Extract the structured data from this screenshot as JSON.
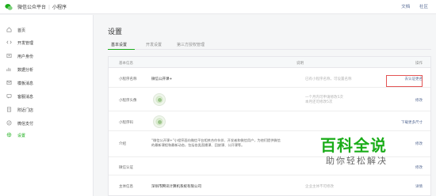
{
  "topbar": {
    "brand": "微信公众平台",
    "product": "小程序",
    "links": [
      "文档",
      "社区"
    ]
  },
  "sidebar": {
    "items": [
      {
        "label": "首页",
        "icon": "home-icon"
      },
      {
        "label": "开发管理",
        "icon": "code-icon"
      },
      {
        "label": "用户身份",
        "icon": "user-icon"
      },
      {
        "label": "数据分析",
        "icon": "chart-icon"
      },
      {
        "label": "模板消息",
        "icon": "message-icon"
      },
      {
        "label": "客服消息",
        "icon": "service-icon"
      },
      {
        "label": "附近门店",
        "icon": "store-icon"
      },
      {
        "label": "微信支付",
        "icon": "pay-icon"
      },
      {
        "label": "设置",
        "icon": "gear-icon",
        "active": true
      }
    ]
  },
  "main": {
    "title": "设置",
    "tabs": [
      "基本设置",
      "开发设置",
      "第三方授权管理"
    ],
    "table": {
      "headers": [
        "基本信息",
        "说明",
        "操作"
      ],
      "rows": [
        {
          "name": "小程序名称",
          "content": "微信公开课+",
          "desc": "已有小程序名称，可设置名称",
          "op": "去认证更名"
        },
        {
          "name": "小程序头像",
          "content": "",
          "desc": "一个月内可申请修改5次\n本月还可修改5次",
          "op": "修改"
        },
        {
          "name": "小程序码",
          "content": "",
          "desc": "",
          "op": "下载更多尺寸"
        },
        {
          "name": "介绍",
          "content": "“微信公开课+”小程序面向微信平台相关合作伙伴、开发者和微信用户，为他们提供微信\n的最新课程和最新动态，包括各类直播课、回放课、公开课等。",
          "desc": "",
          "op": "修改"
        },
        {
          "name": "微信认证",
          "content": "",
          "desc": "",
          "op": "修改"
        },
        {
          "name": "主体信息",
          "content": "深圳市腾讯计算机系统有限公司",
          "desc": "企业主体不可修改",
          "op": "详情"
        }
      ]
    }
  },
  "watermark": {
    "title": "百科全说",
    "subtitle": "助你轻松解决"
  },
  "colors": {
    "accent": "#1aad19",
    "link": "#576b95",
    "highlight": "#e35454"
  }
}
